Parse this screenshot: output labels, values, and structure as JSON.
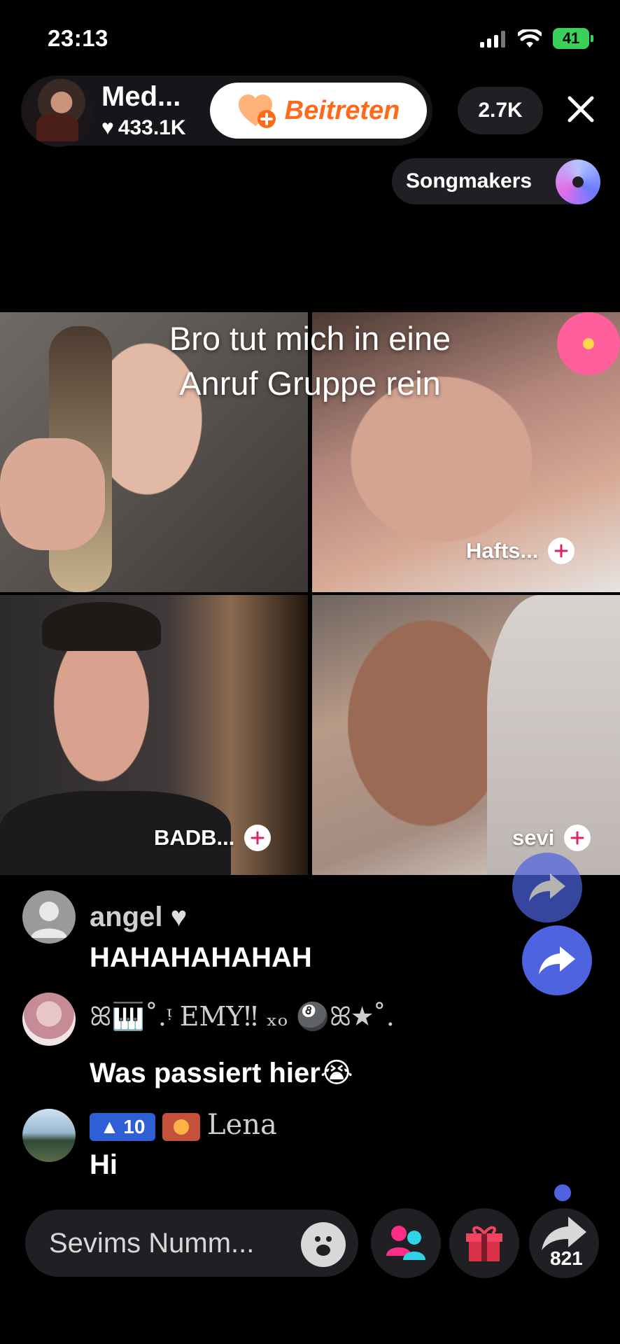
{
  "status": {
    "time": "23:13",
    "battery": "41"
  },
  "host": {
    "name": "Med...",
    "likes": "433.1K",
    "join_label": "Beitreten"
  },
  "viewer_count": "2.7K",
  "songmakers": {
    "label": "Songmakers"
  },
  "overlay_caption": [
    "Bro tut mich in eine",
    "Anruf Gruppe rein"
  ],
  "tiles": [
    {
      "name": ""
    },
    {
      "name": "Hafts..."
    },
    {
      "name": "BADB..."
    },
    {
      "name": "sevi"
    }
  ],
  "comments": [
    {
      "user": "angel",
      "text": "HAHAHAHAHAH"
    },
    {
      "user": "ꕤ🎹˚.ᵎ EMY‼︎ ₓₒ 🎱ꕤ★˚.",
      "text": "Was passiert hier😭"
    },
    {
      "user": "Lena",
      "level": "10",
      "text": "Hi"
    }
  ],
  "bottom": {
    "input_placeholder": "Sevims Numm...",
    "share_count": "821"
  }
}
